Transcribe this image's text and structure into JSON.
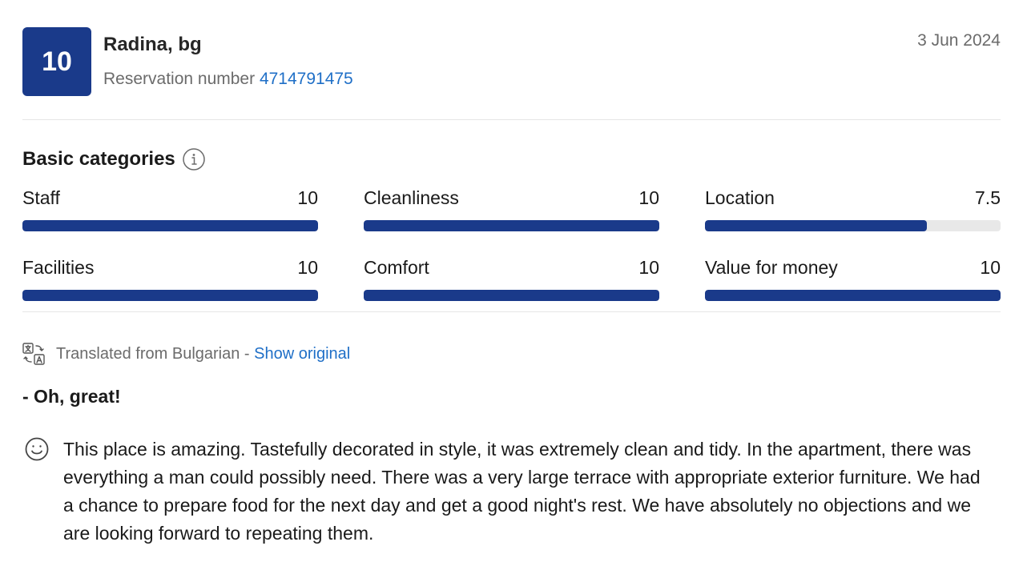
{
  "review": {
    "score": "10",
    "reviewer": "Radina, bg",
    "reservation_label": "Reservation number",
    "reservation_number": "4714791475",
    "date": "3 Jun 2024"
  },
  "categories": {
    "title": "Basic categories",
    "items": [
      {
        "label": "Staff",
        "score": "10",
        "fraction": 1.0
      },
      {
        "label": "Cleanliness",
        "score": "10",
        "fraction": 1.0
      },
      {
        "label": "Location",
        "score": "7.5",
        "fraction": 0.75
      },
      {
        "label": "Facilities",
        "score": "10",
        "fraction": 1.0
      },
      {
        "label": "Comfort",
        "score": "10",
        "fraction": 1.0
      },
      {
        "label": "Value for money",
        "score": "10",
        "fraction": 1.0
      }
    ]
  },
  "translation": {
    "text": "Translated from Bulgarian -",
    "link": "Show original"
  },
  "content": {
    "title": "- Oh, great!",
    "body": "This place is amazing. Tastefully decorated in style, it was extremely clean and tidy. In the apartment, there was everything a man could possibly need. There was a very large terrace with appropriate exterior furniture. We had a chance to prepare food for the next day and get a good night's rest. We have absolutely no objections and we are looking forward to repeating them."
  },
  "colors": {
    "brand_dark_blue": "#1a3a8a",
    "link_blue": "#1f6fc7",
    "bar_track": "#e8e8e8"
  }
}
